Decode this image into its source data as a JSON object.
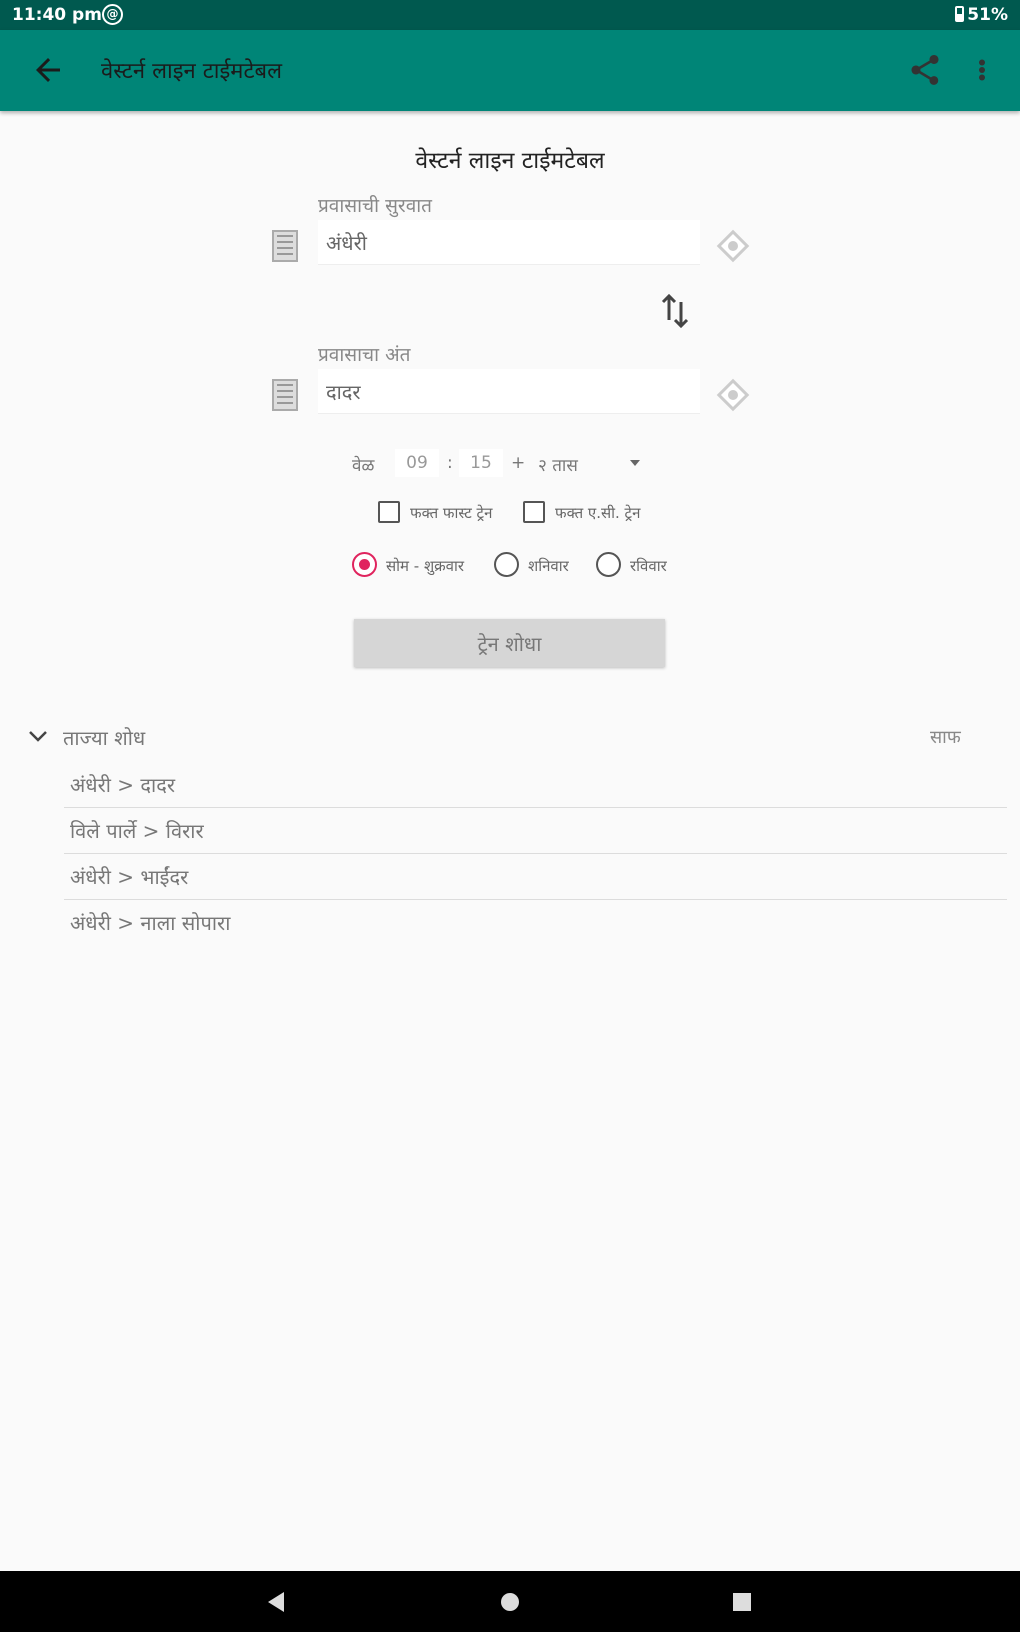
{
  "status_bar": {
    "time": "11:40 pm",
    "vpn_glyph": "@",
    "battery": "51%"
  },
  "app_bar": {
    "title": "वेस्टर्न लाइन टाईमटेबल"
  },
  "content_title": "वेस्टर्न लाइन टाईमटेबल",
  "from": {
    "label": "प्रवासाची सुरवात",
    "value": "अंधेरी"
  },
  "to": {
    "label": "प्रवासाचा अंत",
    "value": "दादर"
  },
  "time": {
    "label": "वेळ",
    "hour": "09",
    "separator": ":",
    "minute": "15",
    "plus": "+",
    "duration": "२ तास"
  },
  "filters": {
    "fast_only": "फक्त फास्ट ट्रेन",
    "ac_only": "फक्त ए.सी. ट्रेन"
  },
  "days": [
    {
      "label": "सोम - शुक्रवार",
      "selected": true
    },
    {
      "label": "शनिवार",
      "selected": false
    },
    {
      "label": "रविवार",
      "selected": false
    }
  ],
  "search_button": "ट्रेन शोधा",
  "recent": {
    "title": "ताज्या शोध",
    "clear_label": "साफ",
    "items": [
      "अंधेरी > दादर",
      "विले पार्ले > विरार",
      "अंधेरी > भाईंदर",
      "अंधेरी > नाला सोपारा"
    ]
  },
  "colors": {
    "primary": "#008577",
    "primary_dark": "#00594f",
    "accent": "#e0245e"
  }
}
